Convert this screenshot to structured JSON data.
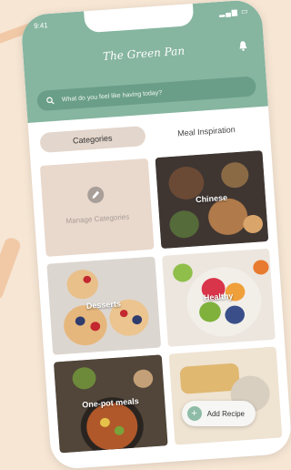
{
  "app": {
    "title": "The Green Pan"
  },
  "status_bar": {
    "time": "9:41",
    "icons": "▂▄▆ ▭"
  },
  "search": {
    "placeholder": "What do you feel like having today?"
  },
  "tabs": [
    {
      "label": "Categories",
      "active": true
    },
    {
      "label": "Meal Inspiration",
      "active": false
    }
  ],
  "categories": [
    {
      "label": "Manage Categories",
      "icon": "edit-icon"
    },
    {
      "label": "Chinese"
    },
    {
      "label": "Desserts"
    },
    {
      "label": "Healthy"
    },
    {
      "label": "One-pot meals"
    },
    {
      "label": ""
    }
  ],
  "fab": {
    "label": "Add Recipe",
    "icon": "plus-icon"
  },
  "colors": {
    "header": "#86b5a0",
    "accent": "#8ebca7",
    "background": "#f7e6d4",
    "tab_active": "#e3d6cc"
  }
}
